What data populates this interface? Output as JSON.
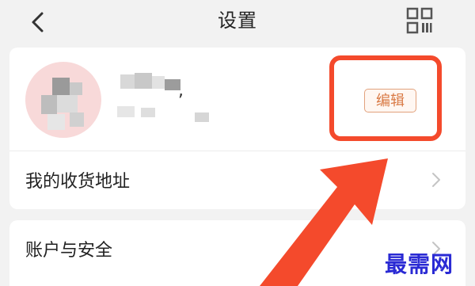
{
  "header": {
    "title": "设置",
    "back_icon": "chevron-left-icon",
    "qr_icon": "qr-code-icon"
  },
  "profile": {
    "edit_label": "编辑",
    "comma": ","
  },
  "menu": {
    "items": [
      {
        "label": "我的收货地址",
        "icon": "chevron-right-icon"
      },
      {
        "label": "账户与安全",
        "icon": "chevron-right-icon"
      }
    ]
  },
  "overlay": {
    "watermark": "最需网",
    "highlight_color": "#f44a2c"
  }
}
